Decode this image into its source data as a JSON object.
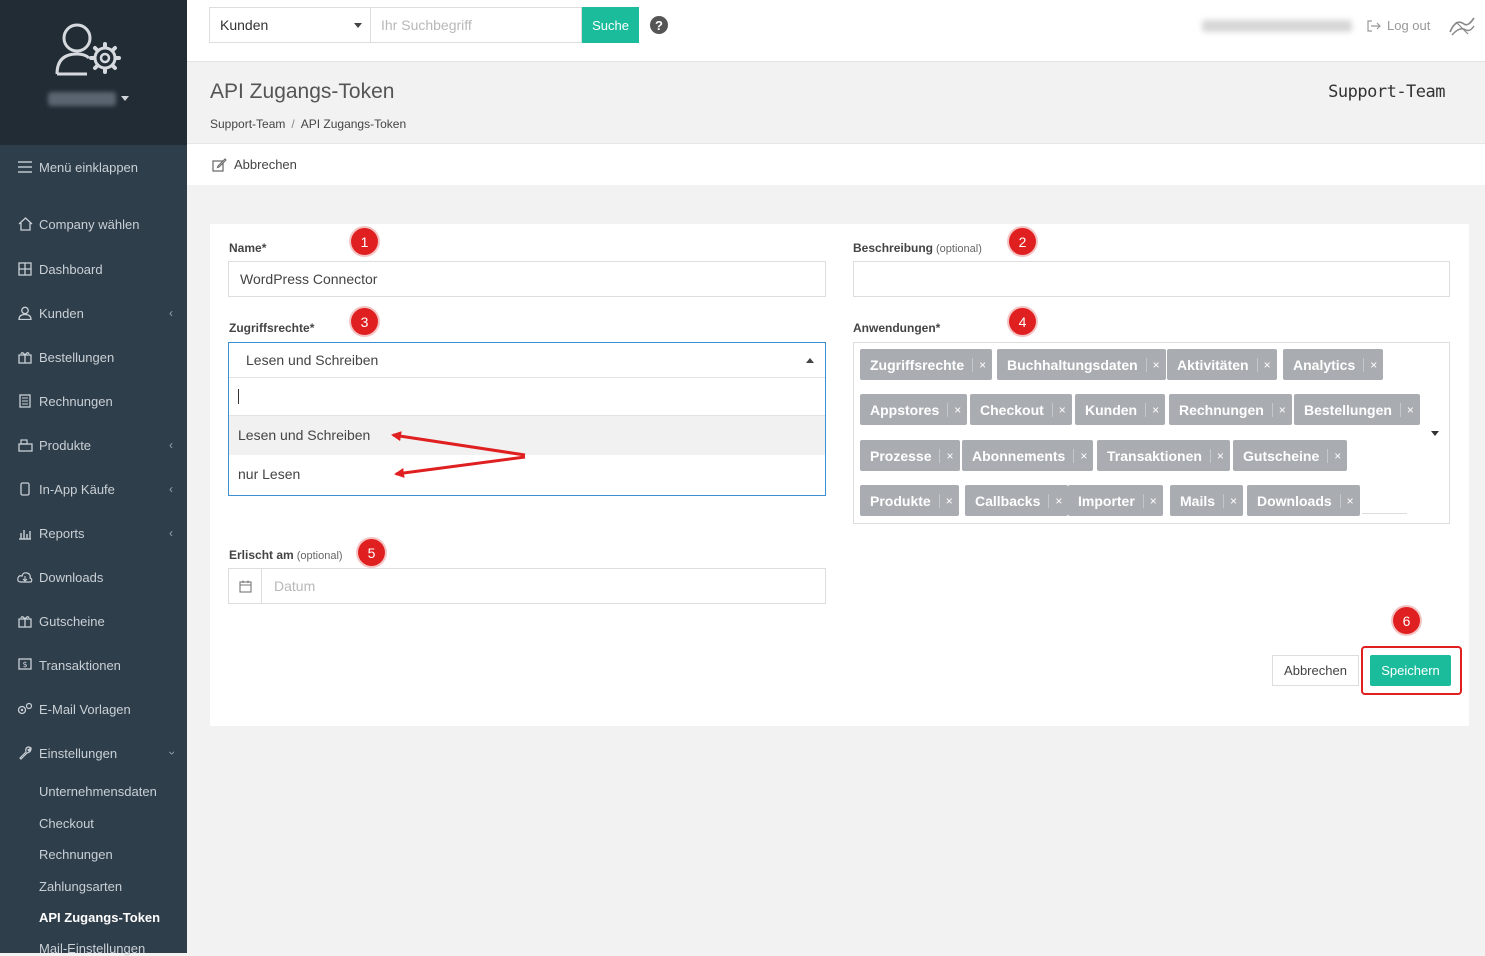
{
  "sidebar": {
    "collapse_label": "Menü einklappen",
    "items": [
      {
        "label": "Company wählen",
        "icon": "home-icon"
      },
      {
        "label": "Dashboard",
        "icon": "grid-icon"
      },
      {
        "label": "Kunden",
        "icon": "user-icon",
        "has_submenu": true
      },
      {
        "label": "Bestellungen",
        "icon": "gift-icon"
      },
      {
        "label": "Rechnungen",
        "icon": "invoice-icon"
      },
      {
        "label": "Produkte",
        "icon": "box-icon",
        "has_submenu": true
      },
      {
        "label": "In-App Käufe",
        "icon": "phone-icon",
        "has_submenu": true
      },
      {
        "label": "Reports",
        "icon": "chart-icon",
        "has_submenu": true
      },
      {
        "label": "Downloads",
        "icon": "cloud-download-icon"
      },
      {
        "label": "Gutscheine",
        "icon": "gift-icon"
      },
      {
        "label": "Transaktionen",
        "icon": "money-icon"
      },
      {
        "label": "E-Mail Vorlagen",
        "icon": "gears-icon"
      },
      {
        "label": "Einstellungen",
        "icon": "wrench-icon",
        "expanded": true
      }
    ],
    "subitems": [
      {
        "label": "Unternehmensdaten"
      },
      {
        "label": "Checkout"
      },
      {
        "label": "Rechnungen"
      },
      {
        "label": "Zahlungsarten"
      },
      {
        "label": "API Zugangs-Token",
        "active": true
      },
      {
        "label": "Mail-Einstellungen"
      }
    ]
  },
  "topbar": {
    "search_scope": "Kunden",
    "search_placeholder": "Ihr Suchbegriff",
    "search_button": "Suche",
    "help": "?",
    "logout": "Log out"
  },
  "header": {
    "title": "API Zugangs-Token",
    "breadcrumb": [
      "Support-Team",
      "API Zugangs-Token"
    ],
    "team": "Support-Team"
  },
  "actions": {
    "cancel": "Abbrechen"
  },
  "form": {
    "name_label": "Name",
    "required_mark": "*",
    "name_value": "WordPress Connector",
    "description_label": "Beschreibung",
    "optional_text": "(optional)",
    "access_label": "Zugriffsrechte",
    "access_selected": "Lesen und Schreiben",
    "access_options": [
      "Lesen und Schreiben",
      "nur Lesen"
    ],
    "apps_label": "Anwendungen",
    "apps_tags": [
      "Zugriffsrechte",
      "Buchhaltungsdaten",
      "Aktivitäten",
      "Analytics",
      "Appstores",
      "Checkout",
      "Kunden",
      "Rechnungen",
      "Bestellungen",
      "Prozesse",
      "Abonnements",
      "Transaktionen",
      "Gutscheine",
      "Produkte",
      "Callbacks",
      "Importer",
      "Mails",
      "Downloads"
    ],
    "tag_remove": "×",
    "expires_label": "Erlischt am",
    "expires_placeholder": "Datum",
    "cancel_button": "Abbrechen",
    "save_button": "Speichern"
  },
  "markers": [
    "1",
    "2",
    "3",
    "4",
    "5",
    "6"
  ],
  "colors": {
    "accent": "#1abc9c",
    "sidebar_bg": "#2f3e4b",
    "annotation_red": "#e02020",
    "tag_bg": "#a9adb1"
  }
}
